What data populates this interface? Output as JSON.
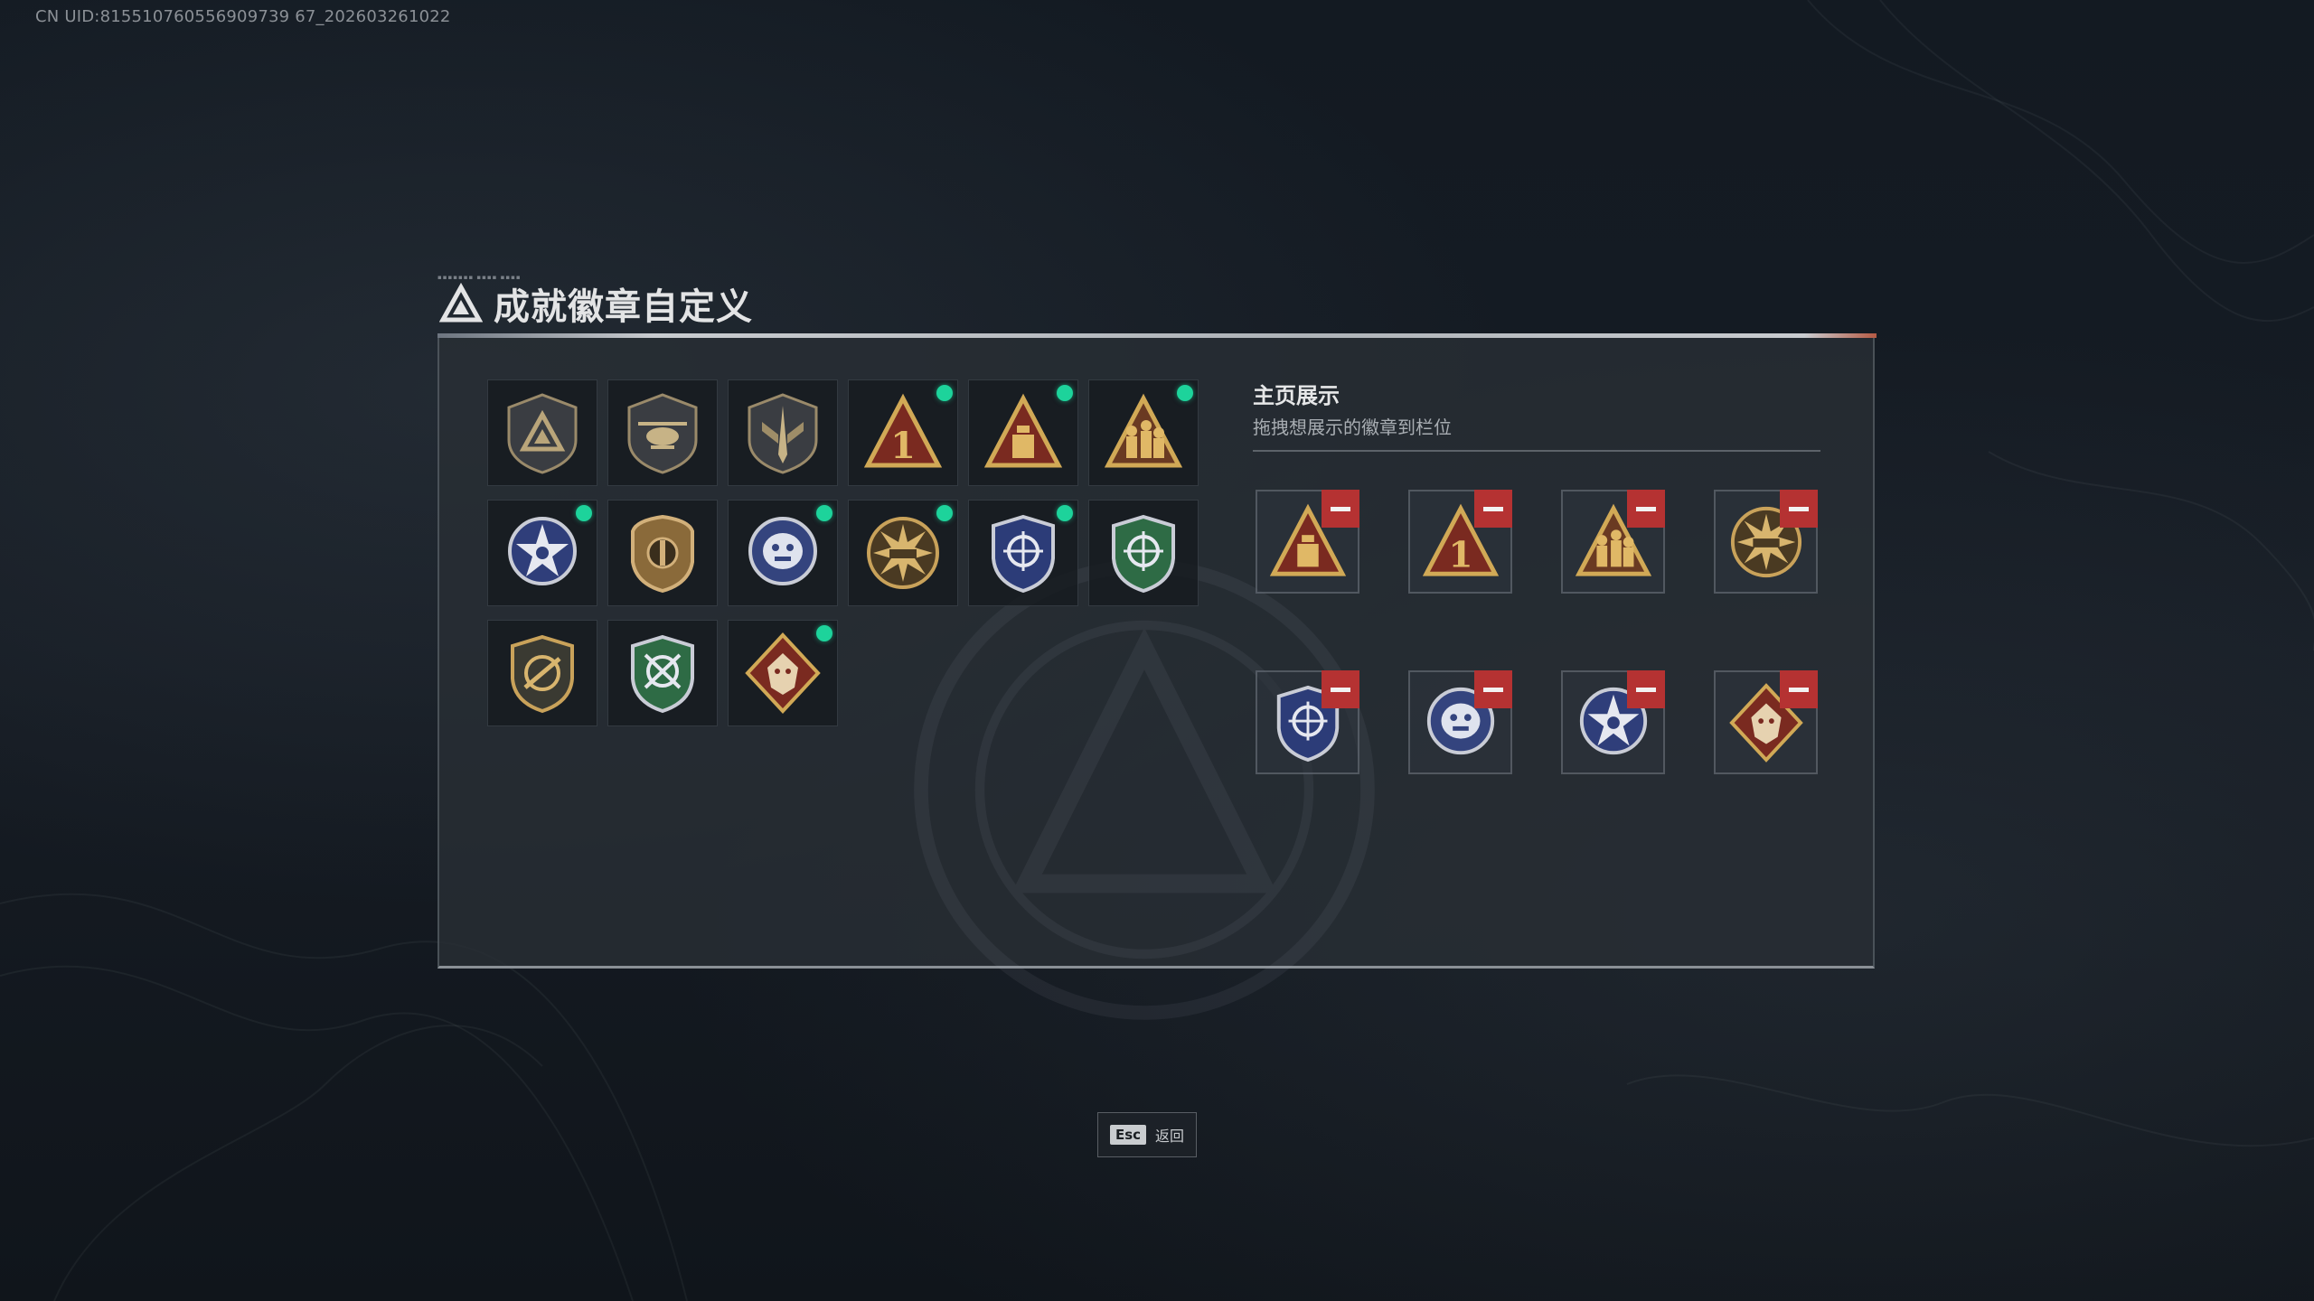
{
  "uid_text": "CN UID:815510760556909739 67_202603261022",
  "header": {
    "title": "成就徽章自定义"
  },
  "collection": {
    "badges": [
      {
        "name": "delta-triangle-badge",
        "new": false
      },
      {
        "name": "helicopter-badge",
        "new": false
      },
      {
        "name": "winged-dagger-badge",
        "new": false
      },
      {
        "name": "number-one-badge",
        "new": true
      },
      {
        "name": "supply-crate-badge",
        "new": true
      },
      {
        "name": "squad-triangle-badge",
        "new": true
      },
      {
        "name": "blue-star-skull-badge",
        "new": true
      },
      {
        "name": "bronze-shield-badge",
        "new": false
      },
      {
        "name": "blue-gorilla-badge",
        "new": true
      },
      {
        "name": "tank-sunburst-badge",
        "new": true
      },
      {
        "name": "blue-crosshair-shield-badge",
        "new": true
      },
      {
        "name": "green-crosshair-shield-badge",
        "new": false
      },
      {
        "name": "rifle-scope-badge",
        "new": false
      },
      {
        "name": "green-arrows-badge",
        "new": false
      },
      {
        "name": "red-wolf-diamond-badge",
        "new": true
      }
    ]
  },
  "display": {
    "title": "主页展示",
    "subtitle": "拖拽想展示的徽章到栏位",
    "slots": [
      {
        "name": "supply-crate-badge"
      },
      {
        "name": "number-one-badge"
      },
      {
        "name": "squad-triangle-badge"
      },
      {
        "name": "tank-sunburst-badge"
      },
      {
        "name": "blue-crosshair-shield-badge"
      },
      {
        "name": "blue-gorilla-badge"
      },
      {
        "name": "blue-star-skull-badge"
      },
      {
        "name": "red-wolf-diamond-badge"
      }
    ]
  },
  "footer": {
    "esc_key": "Esc",
    "back_label": "返回"
  },
  "colors": {
    "new_indicator": "#1dd39b",
    "remove_button": "#b53232",
    "gold": "#c9a25a",
    "blue": "#3a4f9a",
    "green": "#2e6b45",
    "red": "#8a2a22"
  }
}
